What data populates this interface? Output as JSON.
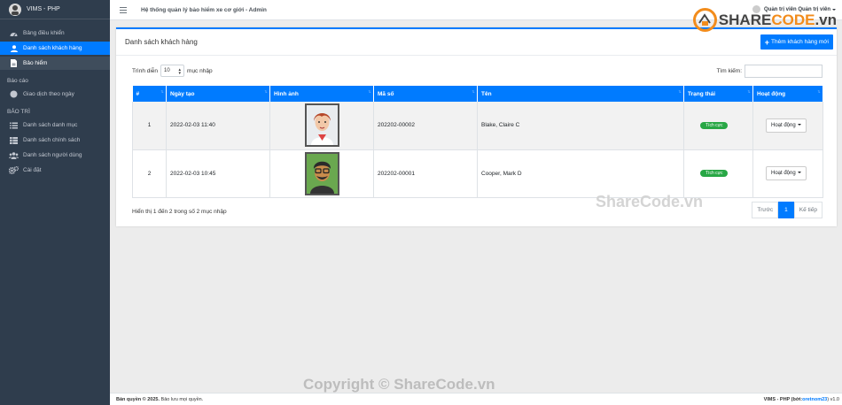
{
  "sidebar": {
    "brand": "VIMS - PHP",
    "items": [
      {
        "label": "Bảng điều khiển",
        "icon": "dashboard-icon"
      },
      {
        "label": "Danh sách khách hàng",
        "icon": "user-icon"
      },
      {
        "label": "Bảo hiểm",
        "icon": "file-icon"
      }
    ],
    "report_header": "Báo cáo",
    "report_items": [
      {
        "label": "Giao dịch theo ngày",
        "icon": "circle-icon"
      }
    ],
    "maintenance_header": "BẢO TRÌ",
    "maintenance_items": [
      {
        "label": "Danh sách danh mục",
        "icon": "list-icon"
      },
      {
        "label": "Danh sách chính sách",
        "icon": "table-icon"
      },
      {
        "label": "Danh sách người dùng",
        "icon": "users-icon"
      },
      {
        "label": "Cài đặt",
        "icon": "gears-icon"
      }
    ]
  },
  "topbar": {
    "title": "Hệ thống quản lý bảo hiểm xe cơ giới - Admin",
    "user": "Quản trị viên Quản trị viên"
  },
  "card": {
    "title": "Danh sách khách hàng",
    "add_button": "Thêm khách hàng mới",
    "length_prefix": "Trình diễn",
    "length_value": "10",
    "length_suffix": "mục nhập",
    "search_label": "Tìm kiếm:",
    "columns": [
      "#",
      "Ngày tạo",
      "Hình ảnh",
      "Mã số",
      "Tên",
      "Trạng thái",
      "Hoạt động"
    ],
    "rows": [
      {
        "no": "1",
        "date": "2022-02-03 11:40",
        "code": "202202-00002",
        "name": "Blake, Claire C",
        "status": "Tích cực",
        "action": "Hoạt động"
      },
      {
        "no": "2",
        "date": "2022-02-03 10:45",
        "code": "202202-00001",
        "name": "Cooper, Mark D",
        "status": "Tích cực",
        "action": "Hoạt động"
      }
    ],
    "info": "Hiển thị 1 đến 2 trong số 2 mục nhập",
    "pager": {
      "prev": "Trước",
      "current": "1",
      "next": "Kế tiếp"
    }
  },
  "footer": {
    "left_a": "Bản quyền © 2025.",
    "left_b": "Bảo lưu mọi quyền.",
    "right_a": "VIMS - PHP (bởi:",
    "right_link": "oretnom23",
    "right_b": ") v1.0"
  },
  "watermark": {
    "logo_a": "SHARE",
    "logo_b": "CODE",
    "logo_c": ".vn",
    "mid": "ShareCode.vn",
    "bottom": "Copyright © ShareCode.vn"
  },
  "colors": {
    "primary": "#007bff",
    "sidebar": "#2f3d4d",
    "success": "#28a745",
    "watermark_orange": "#f28c1c"
  }
}
